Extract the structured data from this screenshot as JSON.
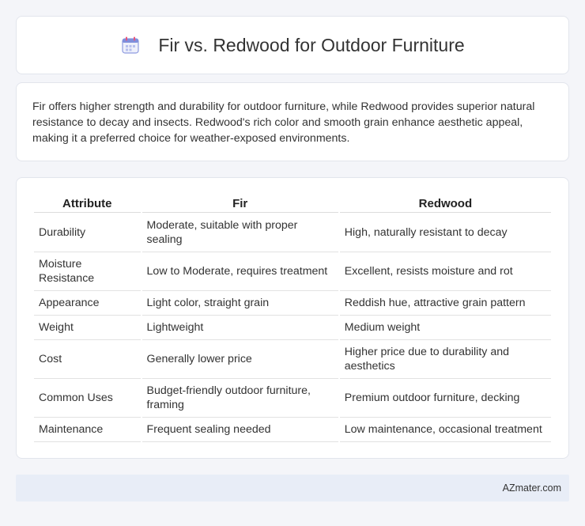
{
  "header": {
    "icon": "calendar-icon",
    "title": "Fir vs. Redwood for Outdoor Furniture"
  },
  "summary": {
    "text": "Fir offers higher strength and durability for outdoor furniture, while Redwood provides superior natural resistance to decay and insects. Redwood's rich color and smooth grain enhance aesthetic appeal, making it a preferred choice for weather-exposed environments."
  },
  "table": {
    "headers": [
      "Attribute",
      "Fir",
      "Redwood"
    ],
    "rows": [
      [
        "Durability",
        "Moderate, suitable with proper sealing",
        "High, naturally resistant to decay"
      ],
      [
        "Moisture Resistance",
        "Low to Moderate, requires treatment",
        "Excellent, resists moisture and rot"
      ],
      [
        "Appearance",
        "Light color, straight grain",
        "Reddish hue, attractive grain pattern"
      ],
      [
        "Weight",
        "Lightweight",
        "Medium weight"
      ],
      [
        "Cost",
        "Generally lower price",
        "Higher price due to durability and aesthetics"
      ],
      [
        "Common Uses",
        "Budget-friendly outdoor furniture, framing",
        "Premium outdoor furniture, decking"
      ],
      [
        "Maintenance",
        "Frequent sealing needed",
        "Low maintenance, occasional treatment"
      ]
    ]
  },
  "footer": {
    "text": "AZmater.com"
  },
  "colors": {
    "background": "#f4f5f9",
    "card": "#ffffff",
    "footer": "#e8edf7",
    "icon_accent": "#6c7fd8"
  }
}
